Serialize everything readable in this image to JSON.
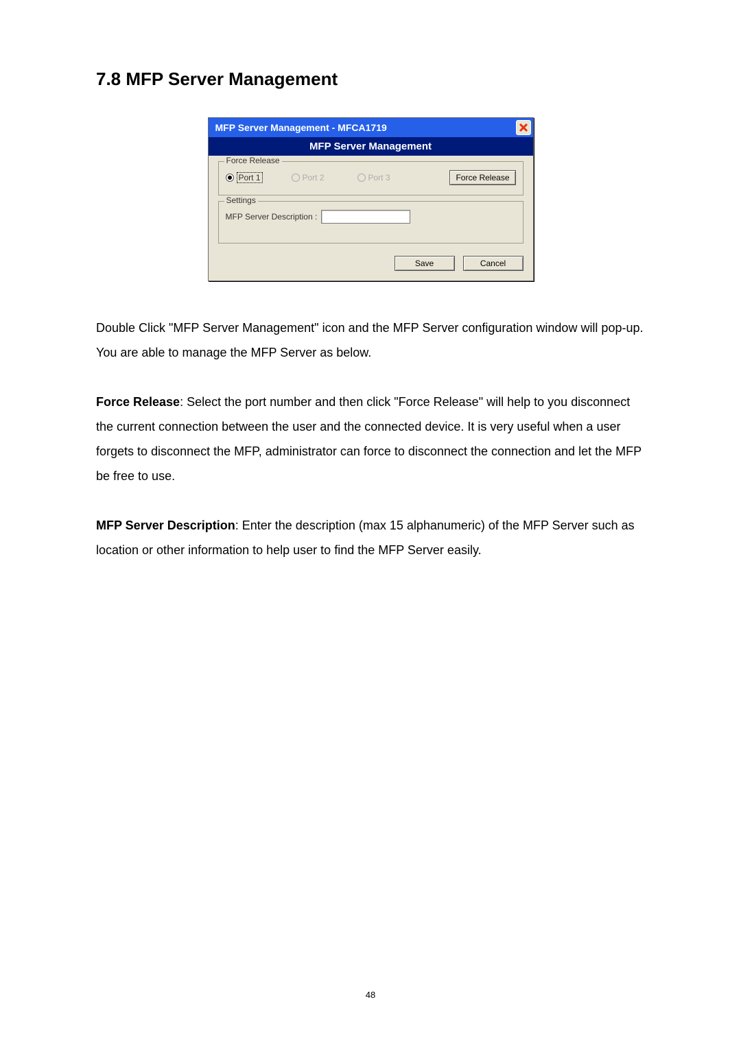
{
  "heading": "7.8    MFP Server Management",
  "dialog": {
    "title": "MFP Server Management - MFCA1719",
    "subtitle": "MFP Server Management",
    "force_release_legend": "Force Release",
    "port1": "Port 1",
    "port2": "Port 2",
    "port3": "Port 3",
    "force_release_btn": "Force Release",
    "settings_legend": "Settings",
    "description_label": "MFP Server Description :",
    "description_value": "",
    "save": "Save",
    "cancel": "Cancel"
  },
  "para1": "Double Click \"MFP Server Management\" icon and the MFP Server configuration window will pop-up. You are able to manage the MFP Server as below.",
  "para2_bold": "Force Release",
  "para2_rest": ": Select the port number and then click \"Force Release\" will help to you disconnect the current connection between the user and the connected device. It is very useful when a user forgets to disconnect the MFP, administrator can force to disconnect the connection and let the MFP be free to use.",
  "para3_bold": "MFP Server Description",
  "para3_rest": ": Enter the description (max 15 alphanumeric) of the MFP Server such as location or other information to help user to find the MFP Server easily.",
  "page_number": "48"
}
